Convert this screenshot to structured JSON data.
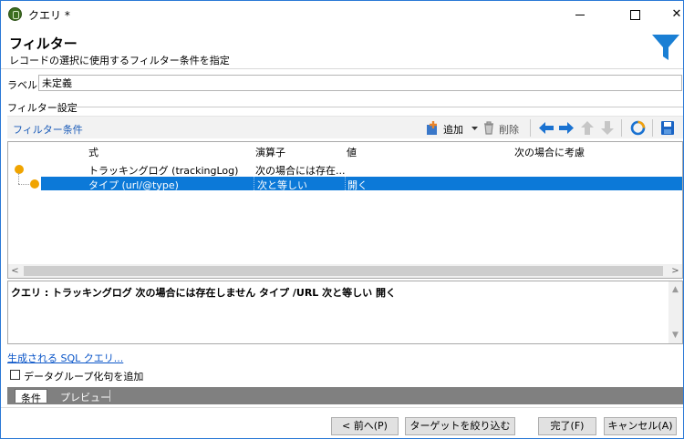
{
  "window": {
    "title": "クエリ *"
  },
  "header": {
    "title": "フィルター",
    "subtitle": "レコードの選択に使用するフィルター条件を指定",
    "icon": "funnel-icon",
    "accent": "#1a7fd4"
  },
  "label": {
    "caption": "ラベル:",
    "value": "未定義"
  },
  "group": {
    "caption": "フィルター設定"
  },
  "toolbar": {
    "title": "フィルター条件",
    "add_label": "追加",
    "delete_label": "削除"
  },
  "grid": {
    "columns": [
      "式",
      "演算子",
      "値",
      "次の場合に考慮"
    ],
    "rows": [
      {
        "expression": "トラッキングログ (trackingLog)",
        "operator": "次の場合には存在...",
        "value": "",
        "consider": "",
        "selected": false
      },
      {
        "expression": "タイプ (url/@type)",
        "operator": "次と等しい",
        "value": "開く",
        "consider": "",
        "selected": true
      }
    ],
    "selection_color": "#0c79d8",
    "node_color": "#f0a400"
  },
  "description": {
    "text": "クエリ : トラッキングログ 次の場合には存在しません タイプ /URL 次と等しい 開く"
  },
  "sql_link": "生成される SQL クエリ...",
  "checkbox": {
    "label": "データグループ化句を追加",
    "checked": false
  },
  "tabs": [
    {
      "label": "条件",
      "active": true
    },
    {
      "label": "プレビュー",
      "active": false
    }
  ],
  "buttons": {
    "prev": "< 前へ(P)",
    "narrow": "ターゲットを絞り込む >",
    "finish": "完了(F)",
    "cancel": "キャンセル(A)"
  }
}
